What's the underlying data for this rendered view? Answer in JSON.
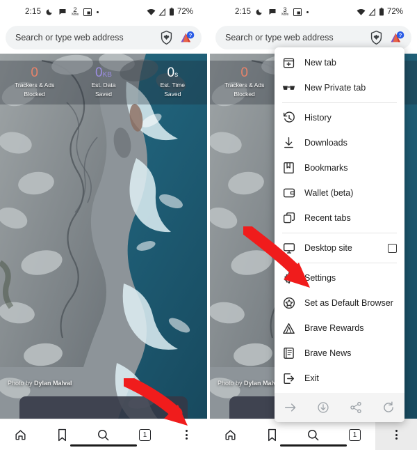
{
  "status_bar": {
    "time": "2:15",
    "net_speed_value": "2",
    "net_speed_unit": "KB/s",
    "net_speed_value_right": "3",
    "battery": "72%",
    "icons": [
      "moon-icon",
      "chat-bubble-icon",
      "network-speed-icon",
      "picture-in-picture-icon",
      "dot-icon",
      "wifi-icon",
      "signal-icon",
      "battery-icon"
    ]
  },
  "omnibox": {
    "placeholder": "Search or type web address",
    "shield_icon": "brave-shield-icon",
    "profile_icon": "brave-rewards-triangle-icon"
  },
  "shields_stats": [
    {
      "value": "0",
      "suffix": "",
      "label_line1": "Trackers & Ads",
      "label_line2": "Blocked",
      "color": "#e8836a"
    },
    {
      "value": "0",
      "suffix": "KB",
      "label_line1": "Est. Data",
      "label_line2": "Saved",
      "color": "#9b8de0"
    },
    {
      "value": "0",
      "suffix": "s",
      "label_line1": "Est. Time",
      "label_line2": "Saved",
      "color": "#ffffff"
    }
  ],
  "photo_credit": {
    "prefix": "Photo by ",
    "author": "Dylan Malval"
  },
  "bottom_nav": [
    {
      "name": "home",
      "icon": "home-icon"
    },
    {
      "name": "bookmarks",
      "icon": "bookmark-icon"
    },
    {
      "name": "search",
      "icon": "search-icon"
    },
    {
      "name": "tabs",
      "icon": "tab-count-icon",
      "count": "1"
    },
    {
      "name": "menu",
      "icon": "kebab-menu-icon"
    }
  ],
  "menu": {
    "items": [
      {
        "label": "New tab",
        "icon": "new-tab-icon",
        "separator_after": false
      },
      {
        "label": "New Private tab",
        "icon": "private-tab-glasses-icon",
        "separator_after": true
      },
      {
        "label": "History",
        "icon": "history-clock-icon",
        "separator_after": false
      },
      {
        "label": "Downloads",
        "icon": "download-icon",
        "separator_after": false
      },
      {
        "label": "Bookmarks",
        "icon": "bookmark-book-icon",
        "separator_after": false
      },
      {
        "label": "Wallet (beta)",
        "icon": "wallet-icon",
        "separator_after": false
      },
      {
        "label": "Recent tabs",
        "icon": "recent-tabs-icon",
        "separator_after": true
      },
      {
        "label": "Desktop site",
        "icon": "desktop-monitor-icon",
        "checkbox": true,
        "checked": false,
        "separator_after": true
      },
      {
        "label": "Settings",
        "icon": "gear-icon",
        "separator_after": false
      },
      {
        "label": "Set as Default Browser",
        "icon": "star-circle-icon",
        "separator_after": false
      },
      {
        "label": "Brave Rewards",
        "icon": "brave-rewards-triangle-icon",
        "separator_after": false
      },
      {
        "label": "Brave News",
        "icon": "news-icon",
        "separator_after": false
      },
      {
        "label": "Exit",
        "icon": "exit-icon",
        "separator_after": false
      }
    ],
    "footer_actions": [
      {
        "name": "forward",
        "icon": "forward-arrow-icon"
      },
      {
        "name": "download-page",
        "icon": "download-circle-icon"
      },
      {
        "name": "share",
        "icon": "share-icon"
      },
      {
        "name": "reload",
        "icon": "reload-icon"
      }
    ]
  },
  "annotations": {
    "arrow_color": "#f01c1c",
    "arrow_left_target": "kebab-menu-icon",
    "arrow_right_target": "Settings"
  }
}
